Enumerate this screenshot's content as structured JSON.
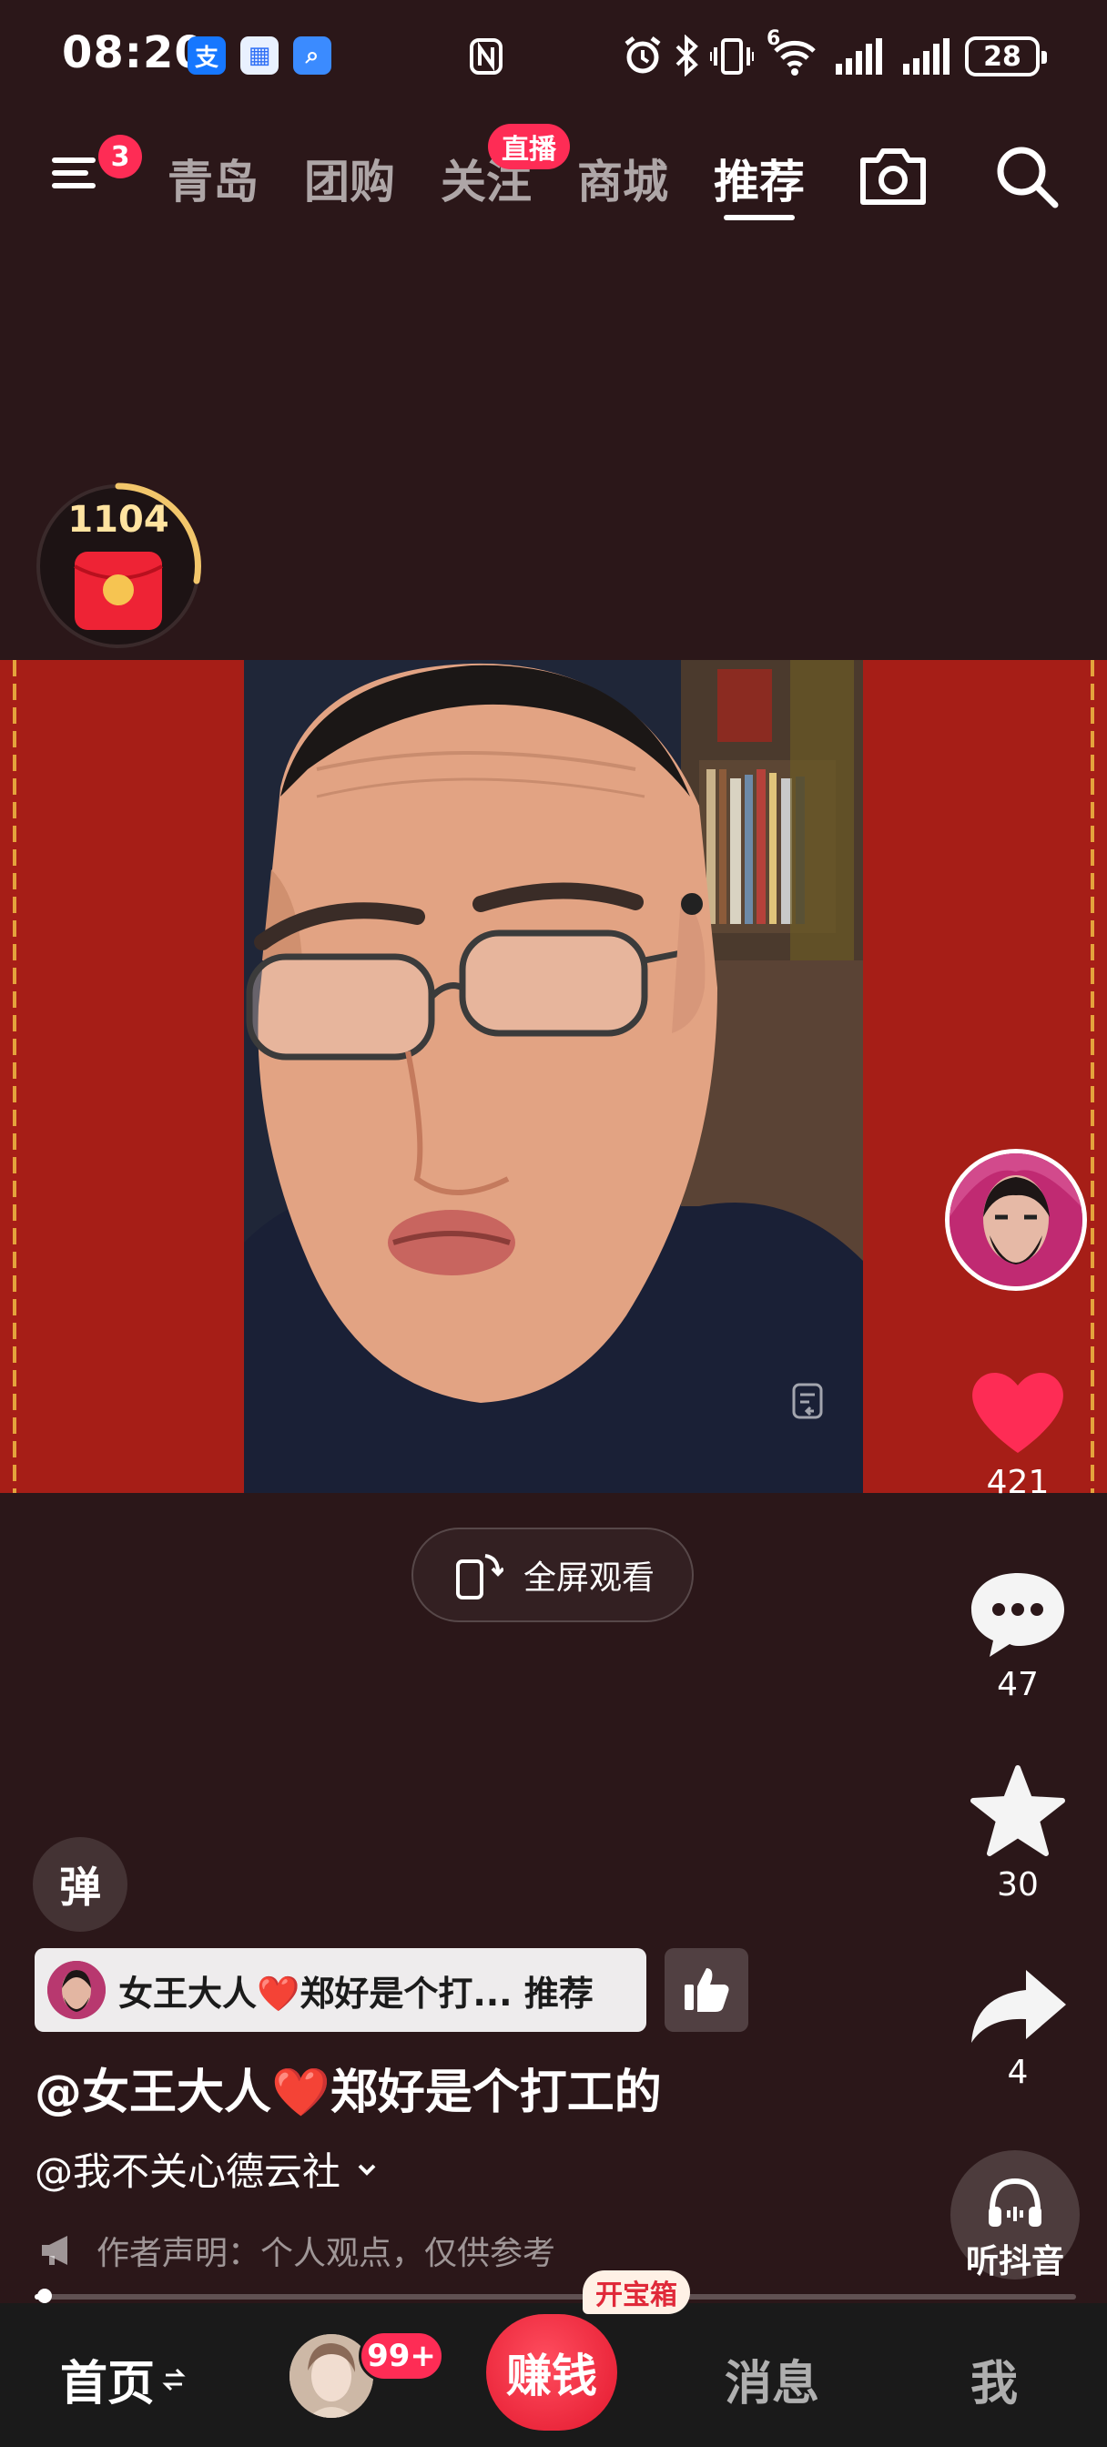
{
  "status_bar": {
    "time": "08:20",
    "battery": "28",
    "network": "6"
  },
  "top_nav": {
    "menu_badge": "3",
    "tabs": [
      "青岛",
      "团购",
      "关注",
      "商城",
      "推荐"
    ],
    "active_tab": "推荐",
    "live_badge": "直播"
  },
  "coin_timer": {
    "count": "1104"
  },
  "video": {
    "fullscreen_label": "全屏观看"
  },
  "rail": {
    "likes": "421",
    "comments": "47",
    "favorites": "30",
    "shares": "4",
    "listen_label": "听抖音"
  },
  "info": {
    "danmaku_label": "弹",
    "recommend_text": "女王大人❤️郑好是个打... 推荐",
    "title": "@女王大人❤️郑好是个打工的",
    "author": "@我不关心德云社",
    "declaration": "作者声明：个人观点，仅供参考"
  },
  "progress": {
    "fraction": 0.01
  },
  "bottom_nav": {
    "home": "首页",
    "friend_badge": "99+",
    "earn": "赚钱",
    "treasure": "开宝箱",
    "messages": "消息",
    "me": "我"
  },
  "colors": {
    "accent": "#fe2c55",
    "video_bg": "#a61e17",
    "page_bg": "#2b1719"
  }
}
